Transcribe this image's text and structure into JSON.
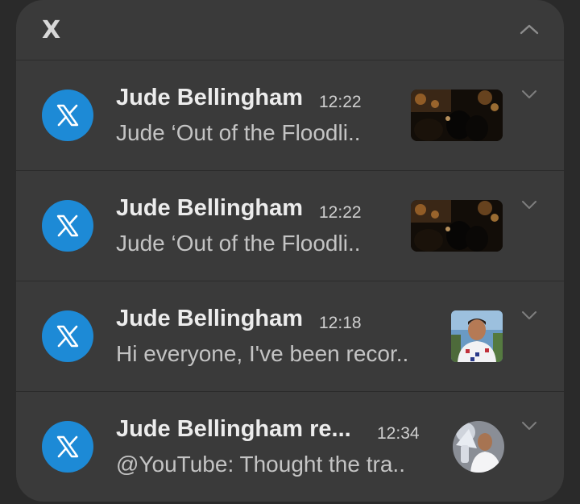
{
  "group": {
    "app_name": "X",
    "collapse_icon": "chevron-up-icon"
  },
  "notifications": [
    {
      "sender": "Jude Bellingham",
      "time": "12:22",
      "message": "Jude ‘Out of the Floodli..",
      "thumbnail": "video-thumbnail",
      "app_icon": "x-logo-icon"
    },
    {
      "sender": "Jude Bellingham",
      "time": "12:22",
      "message": "Jude ‘Out of the Floodli..",
      "thumbnail": "video-thumbnail",
      "app_icon": "x-logo-icon"
    },
    {
      "sender": "Jude Bellingham",
      "time": "12:18",
      "message": "Hi everyone, I've been recor..",
      "thumbnail": "photo-thumbnail",
      "app_icon": "x-logo-icon"
    },
    {
      "sender": "Jude Bellingham re...",
      "time": "12:34",
      "message": "@YouTube: Thought the tra..",
      "thumbnail": "avatar-thumbnail",
      "app_icon": "x-logo-icon"
    }
  ],
  "colors": {
    "background": "#2a2a2a",
    "card": "#3a3a3a",
    "app_icon_bg": "#1d8ad6"
  }
}
